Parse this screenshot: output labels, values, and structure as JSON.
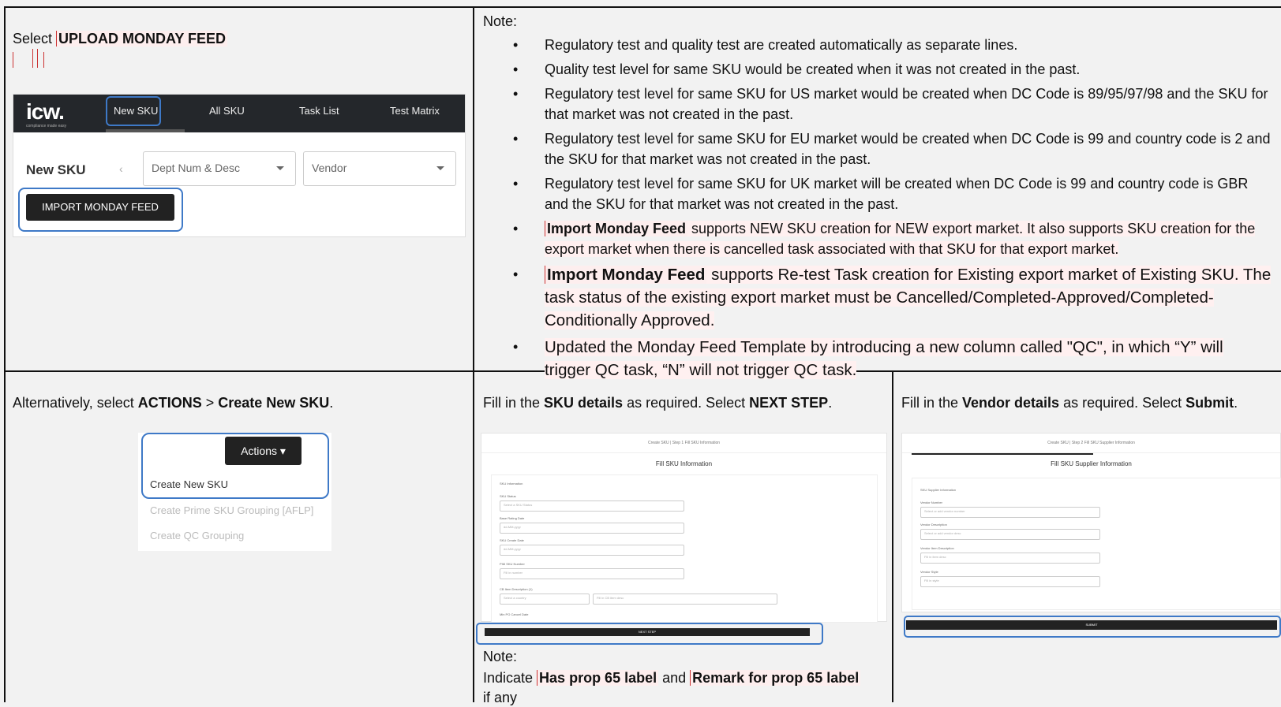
{
  "top_left": {
    "prefix": "Select ",
    "action": "UPLOAD MONDAY FEED"
  },
  "screenshot_nav": {
    "logo": "icw.",
    "logo_sub": "compliance made easy",
    "tabs": [
      "New SKU",
      "All SKU",
      "Task List",
      "Test Matrix"
    ],
    "page_title": "New SKU",
    "filters": [
      "Dept Num & Desc",
      "Vendor"
    ],
    "import_button": "IMPORT MONDAY FEED"
  },
  "notes": {
    "heading": "Note:",
    "items": [
      {
        "text": "Regulatory test and quality test are created automatically as separate lines."
      },
      {
        "text": "Quality test level for same SKU would be created when it was not created in the past."
      },
      {
        "text": "Regulatory test level for same SKU for US market would be created when DC Code is 89/95/97/98 and the SKU for that market was not created in the past."
      },
      {
        "text": "Regulatory test level for same SKU for EU market would be created when DC Code is 99 and country code is 2 and the SKU for that market was not created in the past."
      },
      {
        "text": "Regulatory test level for same SKU for UK market will be created when DC Code is 99 and country code is GBR and the SKU for that market was not created in the past."
      },
      {
        "bold": "Import Monday Feed",
        "text": " supports NEW SKU creation for NEW export market. It also supports SKU creation for the export market when there is cancelled task associated with that SKU for that export market."
      },
      {
        "bold": "Import Monday Feed",
        "text": " supports Re-test Task creation for Existing export market of Existing SKU. The task status of the existing export market must be Cancelled/Completed-Approved/Completed-Conditionally Approved."
      },
      {
        "text": "Updated the Monday Feed Template by introducing a new column called \"QC\", in which “Y” will trigger QC task, “N” will not trigger QC task."
      }
    ]
  },
  "bottom_left": {
    "prefix": "Alternatively, select ",
    "action1": "ACTIONS",
    "sep": " > ",
    "action2": "Create New SKU",
    "suffix": ".",
    "menu": {
      "button": "Actions ▾",
      "items": [
        "Create New SKU",
        "Create Prime SKU Grouping [AFLP]",
        "Create QC Grouping"
      ]
    }
  },
  "bottom_mid": {
    "p1": "Fill in the ",
    "b1": "SKU details",
    "p2": " as required. Select ",
    "b2": "NEXT STEP",
    "p3": ".",
    "form": {
      "header": "Create SKU  |  Step 1 Fill SKU Information",
      "title": "Fill SKU Information",
      "section": "SKU Information",
      "fields": [
        {
          "label": "SKU Status",
          "placeholder": "Select a SKU Status"
        },
        {
          "label": "Base Rating Date",
          "placeholder": "dd-MM-yyyy"
        },
        {
          "label": "SKU Create Date",
          "placeholder": "dd-MM-yyyy"
        },
        {
          "label": "PIM SKU Number",
          "placeholder": "Fill in number"
        },
        {
          "label": "CB Item Description (1)",
          "placeholder": "Select a country"
        },
        {
          "label": "Min PO Cancel Date",
          "placeholder": "Fill in CB item desc"
        }
      ],
      "button": "NEXT STEP"
    },
    "note_heading": "Note:",
    "note_p1": "Indicate ",
    "note_b1": "Has prop 65 label",
    "note_p2": " and ",
    "note_b2": "Remark for prop 65 label",
    "note_p3": "if any"
  },
  "bottom_right": {
    "p1": "Fill in the ",
    "b1": "Vendor details",
    "p2": " as required. Select ",
    "b2": "Submit",
    "p3": ".",
    "form": {
      "header": "Create SKU  |  Step 2 Fill SKU Supplier Information",
      "title": "Fill SKU Supplier Information",
      "section": "SKU Supplier Information",
      "fields": [
        {
          "label": "Vendor Number",
          "placeholder": "Select or add vendor number"
        },
        {
          "label": "Vendor Description",
          "placeholder": "Select or add vendor desc"
        },
        {
          "label": "Vendor Item Description",
          "placeholder": "Fill in item desc"
        },
        {
          "label": "Vendor Style",
          "placeholder": "Fill in style"
        }
      ],
      "button": "SUBMIT"
    }
  }
}
